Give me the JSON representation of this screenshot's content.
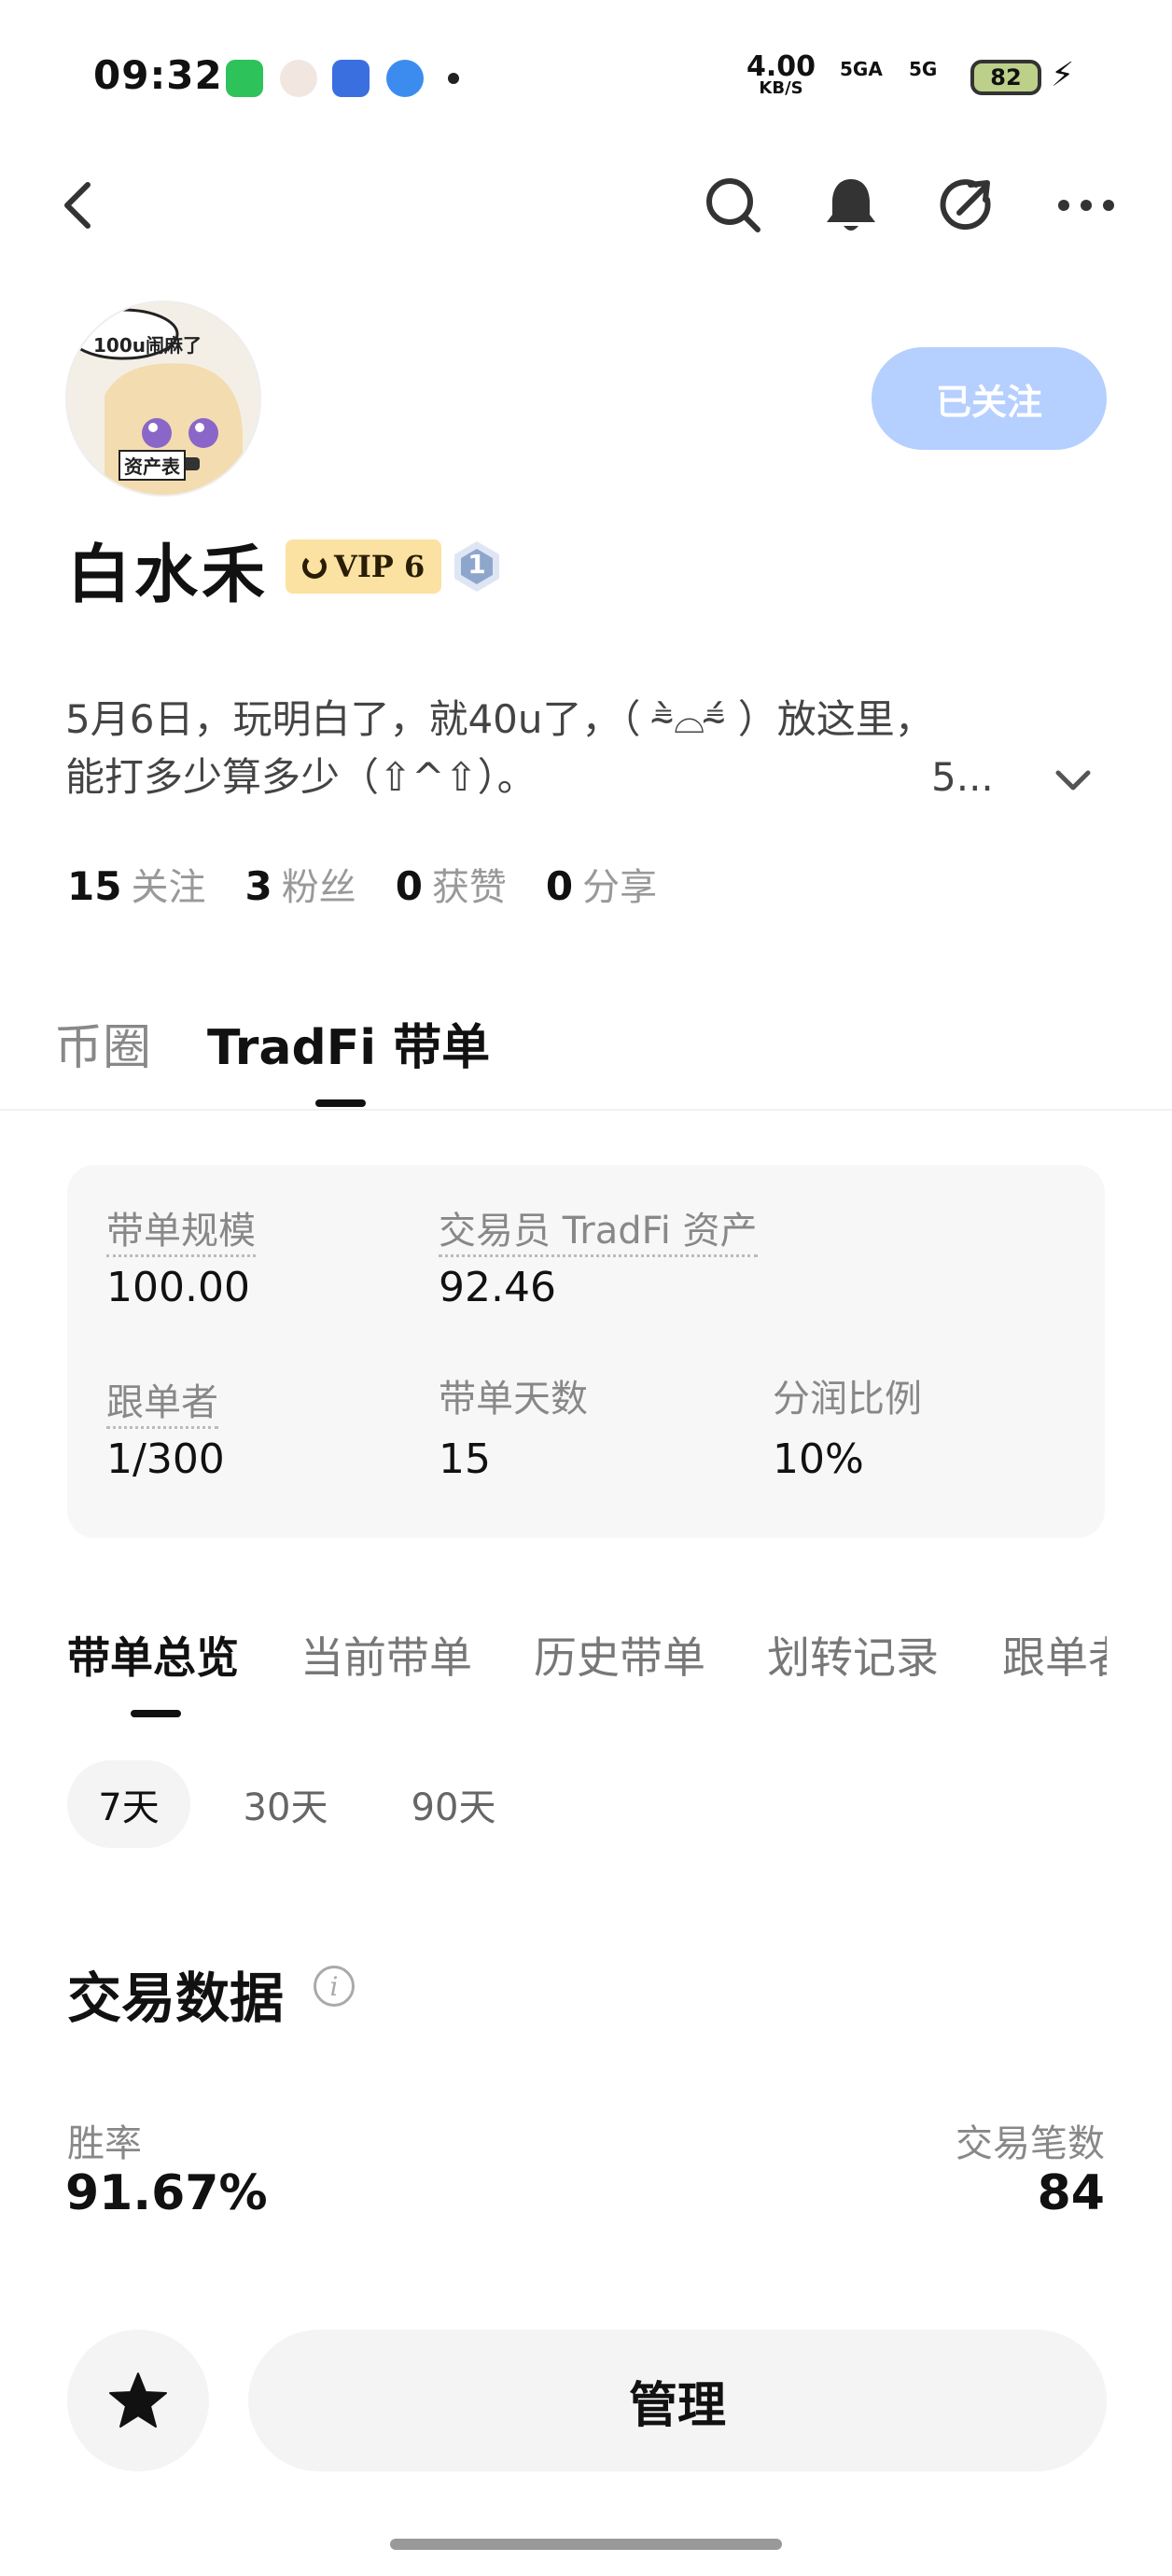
{
  "status_bar": {
    "time": "09:32",
    "net_speed": "4.00",
    "net_unit": "KB/S",
    "signal1": "5GA",
    "signal2": "5G",
    "battery": "82"
  },
  "header": {
    "icons": [
      "back-icon",
      "search-icon",
      "bell-icon",
      "share-icon",
      "more-icon"
    ]
  },
  "profile": {
    "avatar_caption": "100u闹麻了",
    "avatar_sign": "资产表",
    "follow_label": "已关注",
    "name": "白水禾",
    "vip_label": "VIP 6",
    "level": "1",
    "bio_line1": "5月6日，玩明白了，就40u了，（ ⁼̴̀⌓⁼̴́ ）放这里，",
    "bio_line2": "能打多少算多少（⇧^⇧）。",
    "bio_truncated": "5...",
    "stats": [
      {
        "value": "15",
        "label": "关注"
      },
      {
        "value": "3",
        "label": "粉丝"
      },
      {
        "value": "0",
        "label": "获赞"
      },
      {
        "value": "0",
        "label": "分享"
      }
    ]
  },
  "tabs": {
    "tab1": "币圈",
    "tab2": "TradFi 带单"
  },
  "summary": {
    "scale_label": "带单规模",
    "scale_value": "100.00",
    "assets_label": "交易员 TradFi 资产",
    "assets_value": "92.46",
    "followers_label": "跟单者",
    "followers_value": "1/300",
    "days_label": "带单天数",
    "days_value": "15",
    "share_label": "分润比例",
    "share_value": "10%"
  },
  "subtabs": [
    "带单总览",
    "当前带单",
    "历史带单",
    "划转记录",
    "跟单者"
  ],
  "periods": [
    "7天",
    "30天",
    "90天"
  ],
  "trading": {
    "title": "交易数据",
    "win_rate_label": "胜率",
    "win_rate_value": "91.67%",
    "trades_label": "交易笔数",
    "trades_value": "84"
  },
  "bottom": {
    "manage_label": "管理"
  },
  "colors": {
    "follow_button": "#b5cfff",
    "vip_badge": "#fbe2a2",
    "card_bg": "#f7f7f7"
  }
}
